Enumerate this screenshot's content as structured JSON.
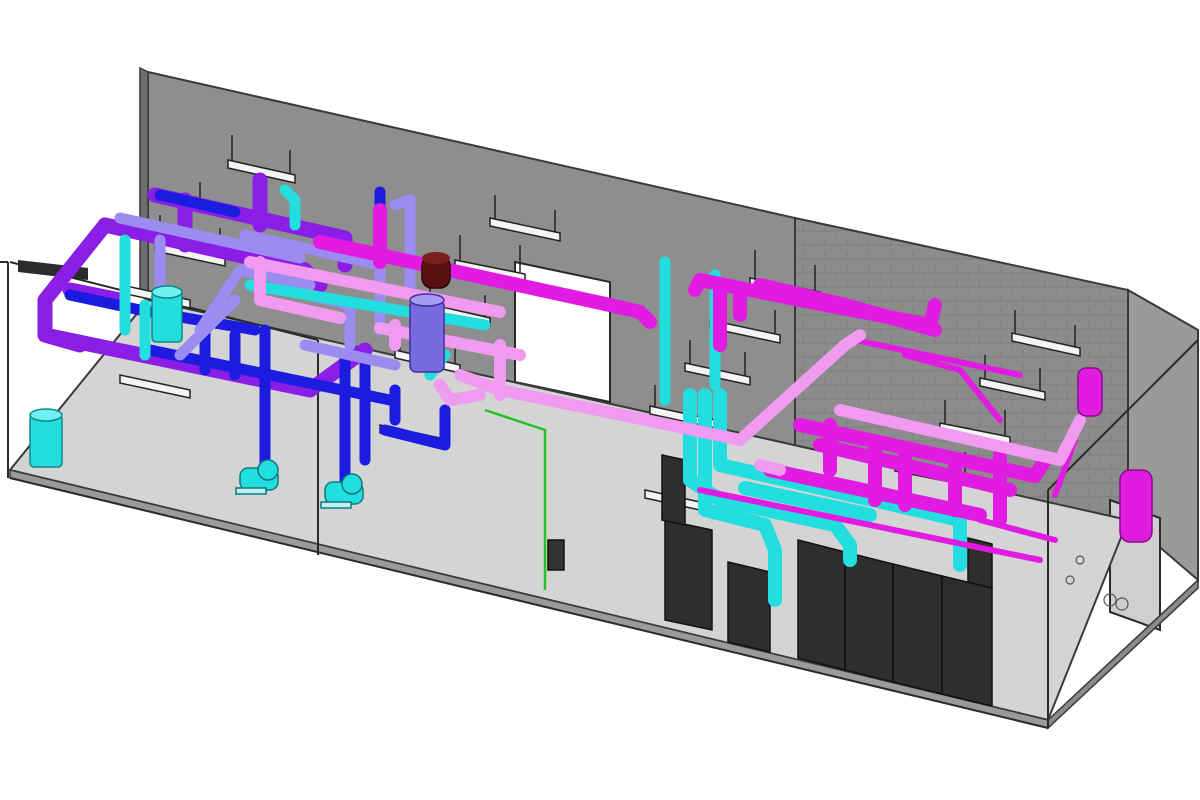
{
  "scene": {
    "kind": "isometric-3d-mechanical-room-model",
    "background": "#ffffff",
    "colors": {
      "wall": "#8a8a8a",
      "wall_dark": "#5e5e5e",
      "wall_edge": "#3a3a3a",
      "floor": "#d2d2d2",
      "glass_edge": "#2b2b2b",
      "magenta_pipe": "#e21be2",
      "pink_pipe": "#f09af0",
      "purple_pipe": "#8a1ee6",
      "violet_pipe": "#9a8cf0",
      "blue_pipe": "#1c1ce0",
      "cyan_pipe": "#22dede",
      "green_line": "#22c322",
      "equipment_dark": "#2e2e2e",
      "tank_dark_red": "#5a1010",
      "light_fixture": "#f4f4f4"
    },
    "elements": [
      "back-wall",
      "floor-slab",
      "glass-partition",
      "light-fixtures",
      "piping-network",
      "circulation-pumps",
      "expansion-tank",
      "electrical-panels",
      "storage-tanks"
    ]
  }
}
